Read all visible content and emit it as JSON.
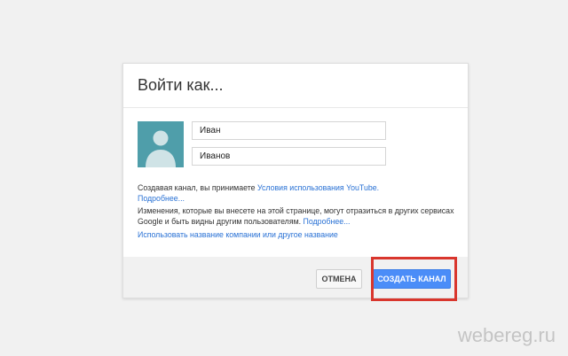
{
  "dialog": {
    "title": "Войти как..."
  },
  "form": {
    "first_name": "Иван",
    "last_name": "Иванов"
  },
  "terms": {
    "text": "Создавая канал, вы принимаете ",
    "link": "Условия использования YouTube.",
    "more": "Подробнее..."
  },
  "notice": {
    "text": "Изменения, которые вы внесете на этой странице, могут отразиться в других сервисах Google и быть видны другим пользователям.",
    "more": "Подробнее..."
  },
  "alt_name_link": "Использовать название компании или другое название",
  "footer": {
    "cancel_label": "ОТМЕНА",
    "create_label": "СОЗДАТЬ КАНАЛ"
  },
  "watermark": "webereg.ru",
  "colors": {
    "avatar_bg": "#4f9eaa",
    "link": "#2a72d5",
    "primary_button": "#4b8df8",
    "highlight": "#d9362d"
  },
  "icons": {
    "avatar": "default-user-silhouette"
  }
}
